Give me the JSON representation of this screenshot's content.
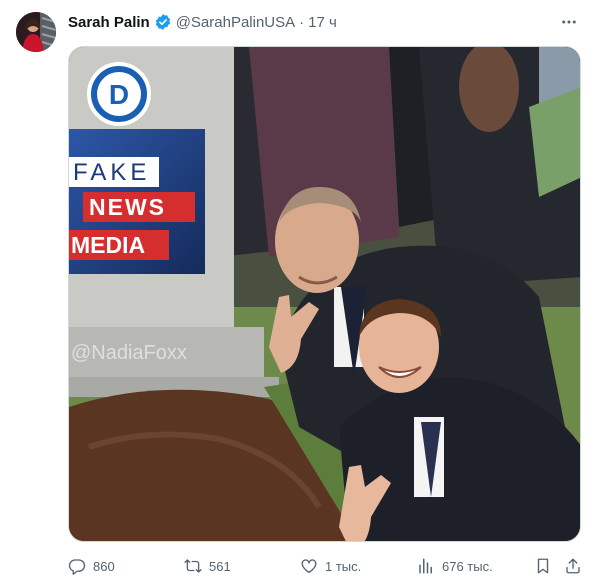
{
  "tweet": {
    "author_name": "Sarah Palin",
    "author_handle": "@SarahPalinUSA",
    "separator": "·",
    "timestamp": "17 ч",
    "verified_color": "#1d9bf0"
  },
  "media": {
    "sign_top": "FAKE",
    "sign_middle": "NEWS",
    "sign_bottom": "MEDIA",
    "logo_letter": "D",
    "watermark": "@NadiaFoxx"
  },
  "actions": {
    "reply_count": "860",
    "repost_count": "561",
    "like_count": "1 тыс.",
    "views_count": "676 тыс."
  },
  "icons": {
    "reply": "reply-icon",
    "repost": "repost-icon",
    "like": "heart-icon",
    "views": "views-icon",
    "bookmark": "bookmark-icon",
    "share": "share-icon",
    "more": "more-icon"
  }
}
